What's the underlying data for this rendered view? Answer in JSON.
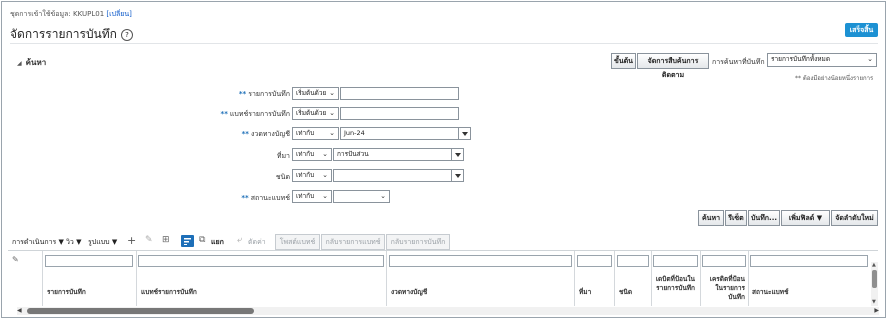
{
  "header": {
    "dataset_label": "ชุดการเข้าใช้ข้อมูล:",
    "dataset_value": "KKUPL01",
    "change_link": "[เปลี่ยน]",
    "page_title": "จัดการรายการบันทึก",
    "help_icon": "?",
    "done_button": "เสร็จสิ้น"
  },
  "search_bar": {
    "basic_button": "ขั้นต้น",
    "manage_saved_button": "จัดการสืบค้นการติดตาม",
    "saved_search_label": "การค้นหาที่บันทึก",
    "saved_search_value": "รายการบันทึกทั้งหมด",
    "required_note": "** ต้องมีอย่างน้อยหนึ่งรายการ"
  },
  "search_section": {
    "title": "ค้นหา",
    "fields": [
      {
        "label": "รายการบันทึก",
        "required": "**",
        "operator": "เริ่มต้นด้วย",
        "value": ""
      },
      {
        "label": "แบทช์รายการบันทึก",
        "required": "**",
        "operator": "เริ่มต้นด้วย",
        "value": ""
      },
      {
        "label": "งวดทางบัญชี",
        "required": "**",
        "operator": "เท่ากับ",
        "value": "Jun-24"
      },
      {
        "label": "ที่มา",
        "required": "",
        "operator": "เท่ากับ",
        "value": "การปันส่วน"
      },
      {
        "label": "ชนิด",
        "required": "",
        "operator": "เท่ากับ",
        "value": ""
      },
      {
        "label": "สถานะแบทช์",
        "required": "**",
        "operator": "เท่ากับ",
        "value": ""
      }
    ],
    "buttons": {
      "search": "ค้นหา",
      "reset": "รีเซ็ต",
      "save": "บันทึก...",
      "add_fields": "เพิ่มฟิลด์",
      "reorder": "จัดลำดับใหม่"
    }
  },
  "results_toolbar": {
    "actions": "การดำเนินการ",
    "view": "วิว",
    "format": "รูปแบบ",
    "detach": "แยก",
    "edit_value": "ตัดค่า",
    "post_batch": "โพสต์แบทช์",
    "reverse_batch": "กลับรายการแบทช์",
    "reverse_journal": "กลับรายการบันทึก"
  },
  "table": {
    "columns": [
      "รายการบันทึก",
      "แบทช์รายการบันทึก",
      "งวดทางบัญชี",
      "ที่มา",
      "ชนิด",
      "เดบิตที่ป้อนในรายการบันทึก",
      "เครดิตที่ป้อนในรายการบันทึก",
      "สถานะแบทช์"
    ]
  }
}
